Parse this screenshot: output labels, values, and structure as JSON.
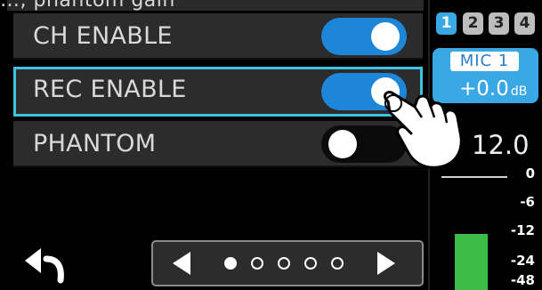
{
  "top_cut_text": "…, phantom gain",
  "rows": [
    {
      "label": "CH ENABLE",
      "state": "on"
    },
    {
      "label": "REC ENABLE",
      "state": "on",
      "selected": true
    },
    {
      "label": "PHANTOM",
      "state": "off"
    }
  ],
  "pager": {
    "total_pages": 5,
    "current_page": 1
  },
  "channel_tabs": [
    "1",
    "2",
    "3",
    "4"
  ],
  "active_channel": "1",
  "channel_name": "MIC 1",
  "gain_value": "+0.0",
  "gain_unit": "dB",
  "level_readout": "12.0",
  "meter_scale": [
    "0",
    "-6",
    "-12",
    "-24",
    "-48"
  ],
  "colors": {
    "toggle_on": "#1e86d8",
    "selection_border": "#3fc3e2",
    "meter_green": "#3dbd45",
    "channel_blue": "#3ba8e6"
  },
  "icons": {
    "back": "back-arrow-icon",
    "hand": "pointing-hand-icon"
  }
}
